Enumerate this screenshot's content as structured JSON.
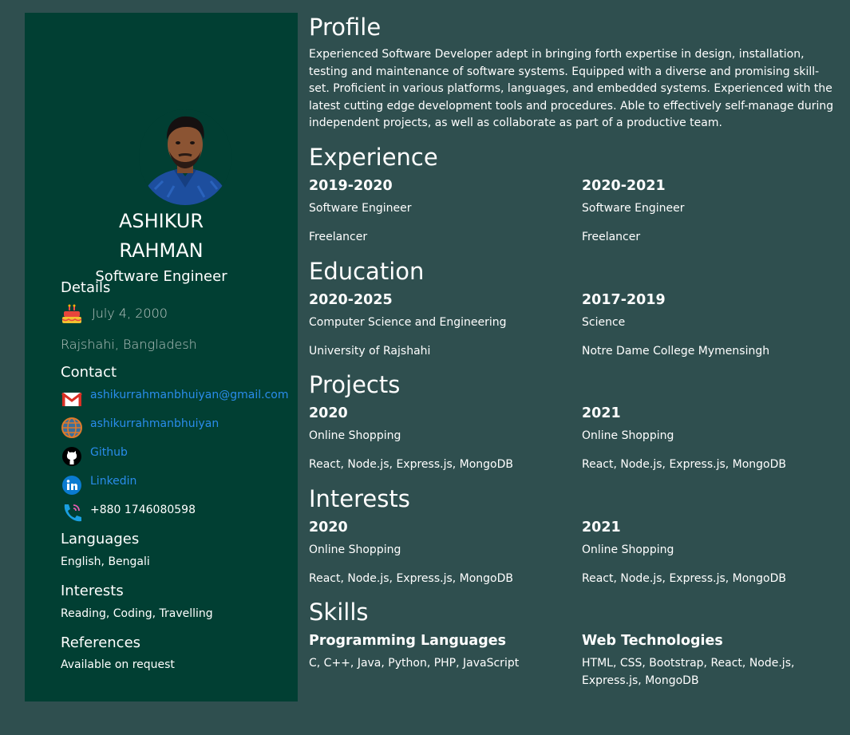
{
  "sidebar": {
    "name_first": "ASHIKUR",
    "name_last": "RAHMAN",
    "role": "Software Engineer",
    "details_heading": "Details",
    "birthday": "July 4, 2000",
    "location": "Rajshahi, Bangladesh",
    "contact_heading": "Contact",
    "email": "ashikurrahmanbhuiyan@gmail.com",
    "website": "ashikurrahmanbhuiyan",
    "github": "Github",
    "linkedin": "Linkedin",
    "phone": "+880 1746080598",
    "languages_heading": "Languages",
    "languages": "English, Bengali",
    "interests_heading": "Interests",
    "interests": "Reading, Coding, Travelling",
    "references_heading": "References",
    "references": "Available on request"
  },
  "profile": {
    "heading": "Profile",
    "text": "Experienced Software Developer adept in bringing forth expertise in design, installation, testing and maintenance of software systems. Equipped with a diverse and promising skill-set. Proficient in various platforms, languages, and embedded systems. Experienced with the latest cutting edge development tools and procedures. Able to effectively self-manage during independent projects, as well as collaborate as part of a productive team."
  },
  "experience": {
    "heading": "Experience",
    "items": [
      {
        "year": "2019-2020",
        "line1": "Software Engineer",
        "line2": "Freelancer"
      },
      {
        "year": "2020-2021",
        "line1": "Software Engineer",
        "line2": "Freelancer"
      }
    ]
  },
  "education": {
    "heading": "Education",
    "items": [
      {
        "year": "2020-2025",
        "line1": "Computer Science and Engineering",
        "line2": "University of Rajshahi"
      },
      {
        "year": "2017-2019",
        "line1": "Science",
        "line2": "Notre Dame College Mymensingh"
      }
    ]
  },
  "projects": {
    "heading": "Projects",
    "items": [
      {
        "year": "2020",
        "line1": "Online Shopping",
        "line2": "React, Node.js, Express.js, MongoDB"
      },
      {
        "year": "2021",
        "line1": "Online Shopping",
        "line2": "React, Node.js, Express.js, MongoDB"
      }
    ]
  },
  "interests_main": {
    "heading": "Interests",
    "items": [
      {
        "year": "2020",
        "line1": "Online Shopping",
        "line2": "React, Node.js, Express.js, MongoDB"
      },
      {
        "year": "2021",
        "line1": "Online Shopping",
        "line2": "React, Node.js, Express.js, MongoDB"
      }
    ]
  },
  "skills": {
    "heading": "Skills",
    "items": [
      {
        "title": "Programming Languages",
        "text": "C, C++, Java, Python, PHP, JavaScript"
      },
      {
        "title": "Web Technologies",
        "text": "HTML, CSS, Bootstrap, React, Node.js, Express.js, MongoDB"
      }
    ]
  },
  "icons": {
    "birthday": "birthday-cake-icon",
    "email": "gmail-icon",
    "website": "globe-icon",
    "github": "github-icon",
    "linkedin": "linkedin-icon",
    "phone": "phone-icon"
  },
  "colors": {
    "page_background": "#2f4f4f",
    "sidebar_background": "#013f33",
    "link": "#2a8ceb",
    "text": "#ffffff"
  }
}
